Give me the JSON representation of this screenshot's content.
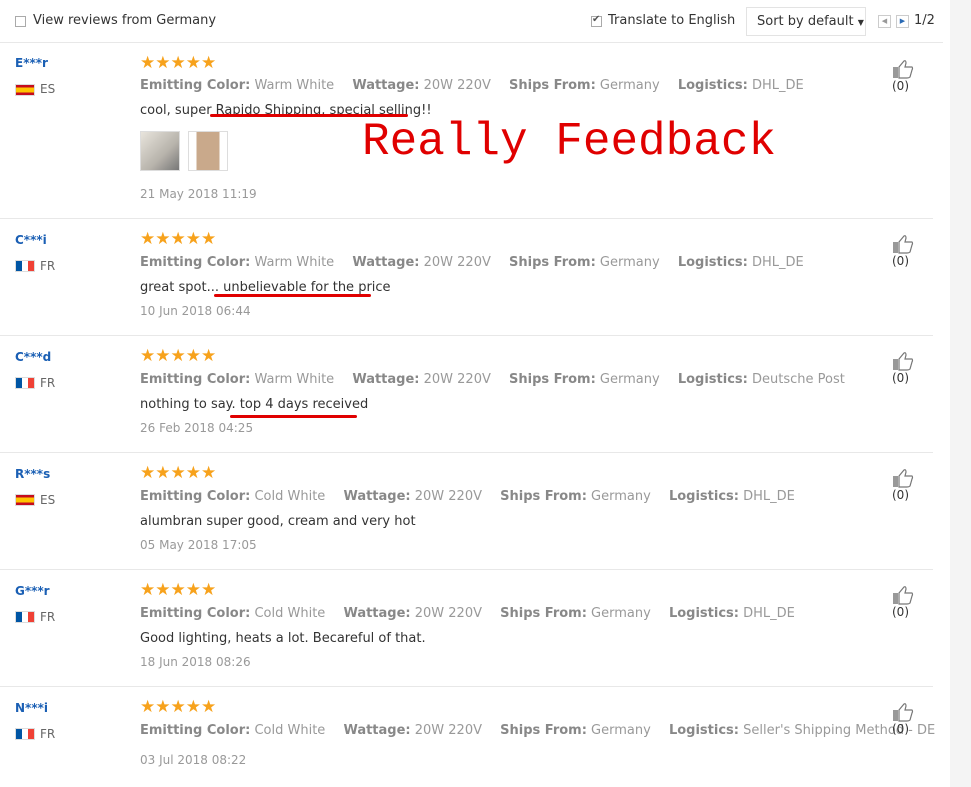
{
  "topbar": {
    "view_reviews_label": "View reviews from Germany",
    "translate_label": "Translate to English",
    "sort_label": "Sort by default",
    "page_indicator": "1/2"
  },
  "annotation": "Really Feedback",
  "labels": {
    "color": "Emitting Color:",
    "wattage": "Wattage:",
    "ships": "Ships From:",
    "logistics": "Logistics:"
  },
  "stars": "★★★★★",
  "reviews": [
    {
      "user": "E***r",
      "country": "ES",
      "color": "Warm White",
      "wattage": "20W 220V",
      "ships": "Germany",
      "logistics": "DHL_DE",
      "content": "cool, super Rapido Shipping, special selling!!",
      "date": "21 May 2018 11:19",
      "likes": "(0)"
    },
    {
      "user": "C***i",
      "country": "FR",
      "color": "Warm White",
      "wattage": "20W 220V",
      "ships": "Germany",
      "logistics": "DHL_DE",
      "content": "great spot... unbelievable for the price",
      "date": "10 Jun 2018 06:44",
      "likes": "(0)"
    },
    {
      "user": "C***d",
      "country": "FR",
      "color": "Warm White",
      "wattage": "20W 220V",
      "ships": "Germany",
      "logistics": "Deutsche Post",
      "content": "nothing to say. top 4 days received",
      "date": "26 Feb 2018 04:25",
      "likes": "(0)"
    },
    {
      "user": "R***s",
      "country": "ES",
      "color": "Cold White",
      "wattage": "20W 220V",
      "ships": "Germany",
      "logistics": "DHL_DE",
      "content": "alumbran super good, cream and very hot",
      "date": "05 May 2018 17:05",
      "likes": "(0)"
    },
    {
      "user": "G***r",
      "country": "FR",
      "color": "Cold White",
      "wattage": "20W 220V",
      "ships": "Germany",
      "logistics": "DHL_DE",
      "content": "Good lighting, heats a lot. Becareful of that.",
      "date": "18 Jun 2018 08:26",
      "likes": "(0)"
    },
    {
      "user": "N***i",
      "country": "FR",
      "color": "Cold White",
      "wattage": "20W 220V",
      "ships": "Germany",
      "logistics": "Seller's Shipping Method - DE",
      "content": "",
      "date": "03 Jul 2018 08:22",
      "likes": "(0)"
    }
  ],
  "colors": {
    "accent": "#f7a21c",
    "user": "#1a5fb4",
    "highlight": "#e00000"
  }
}
